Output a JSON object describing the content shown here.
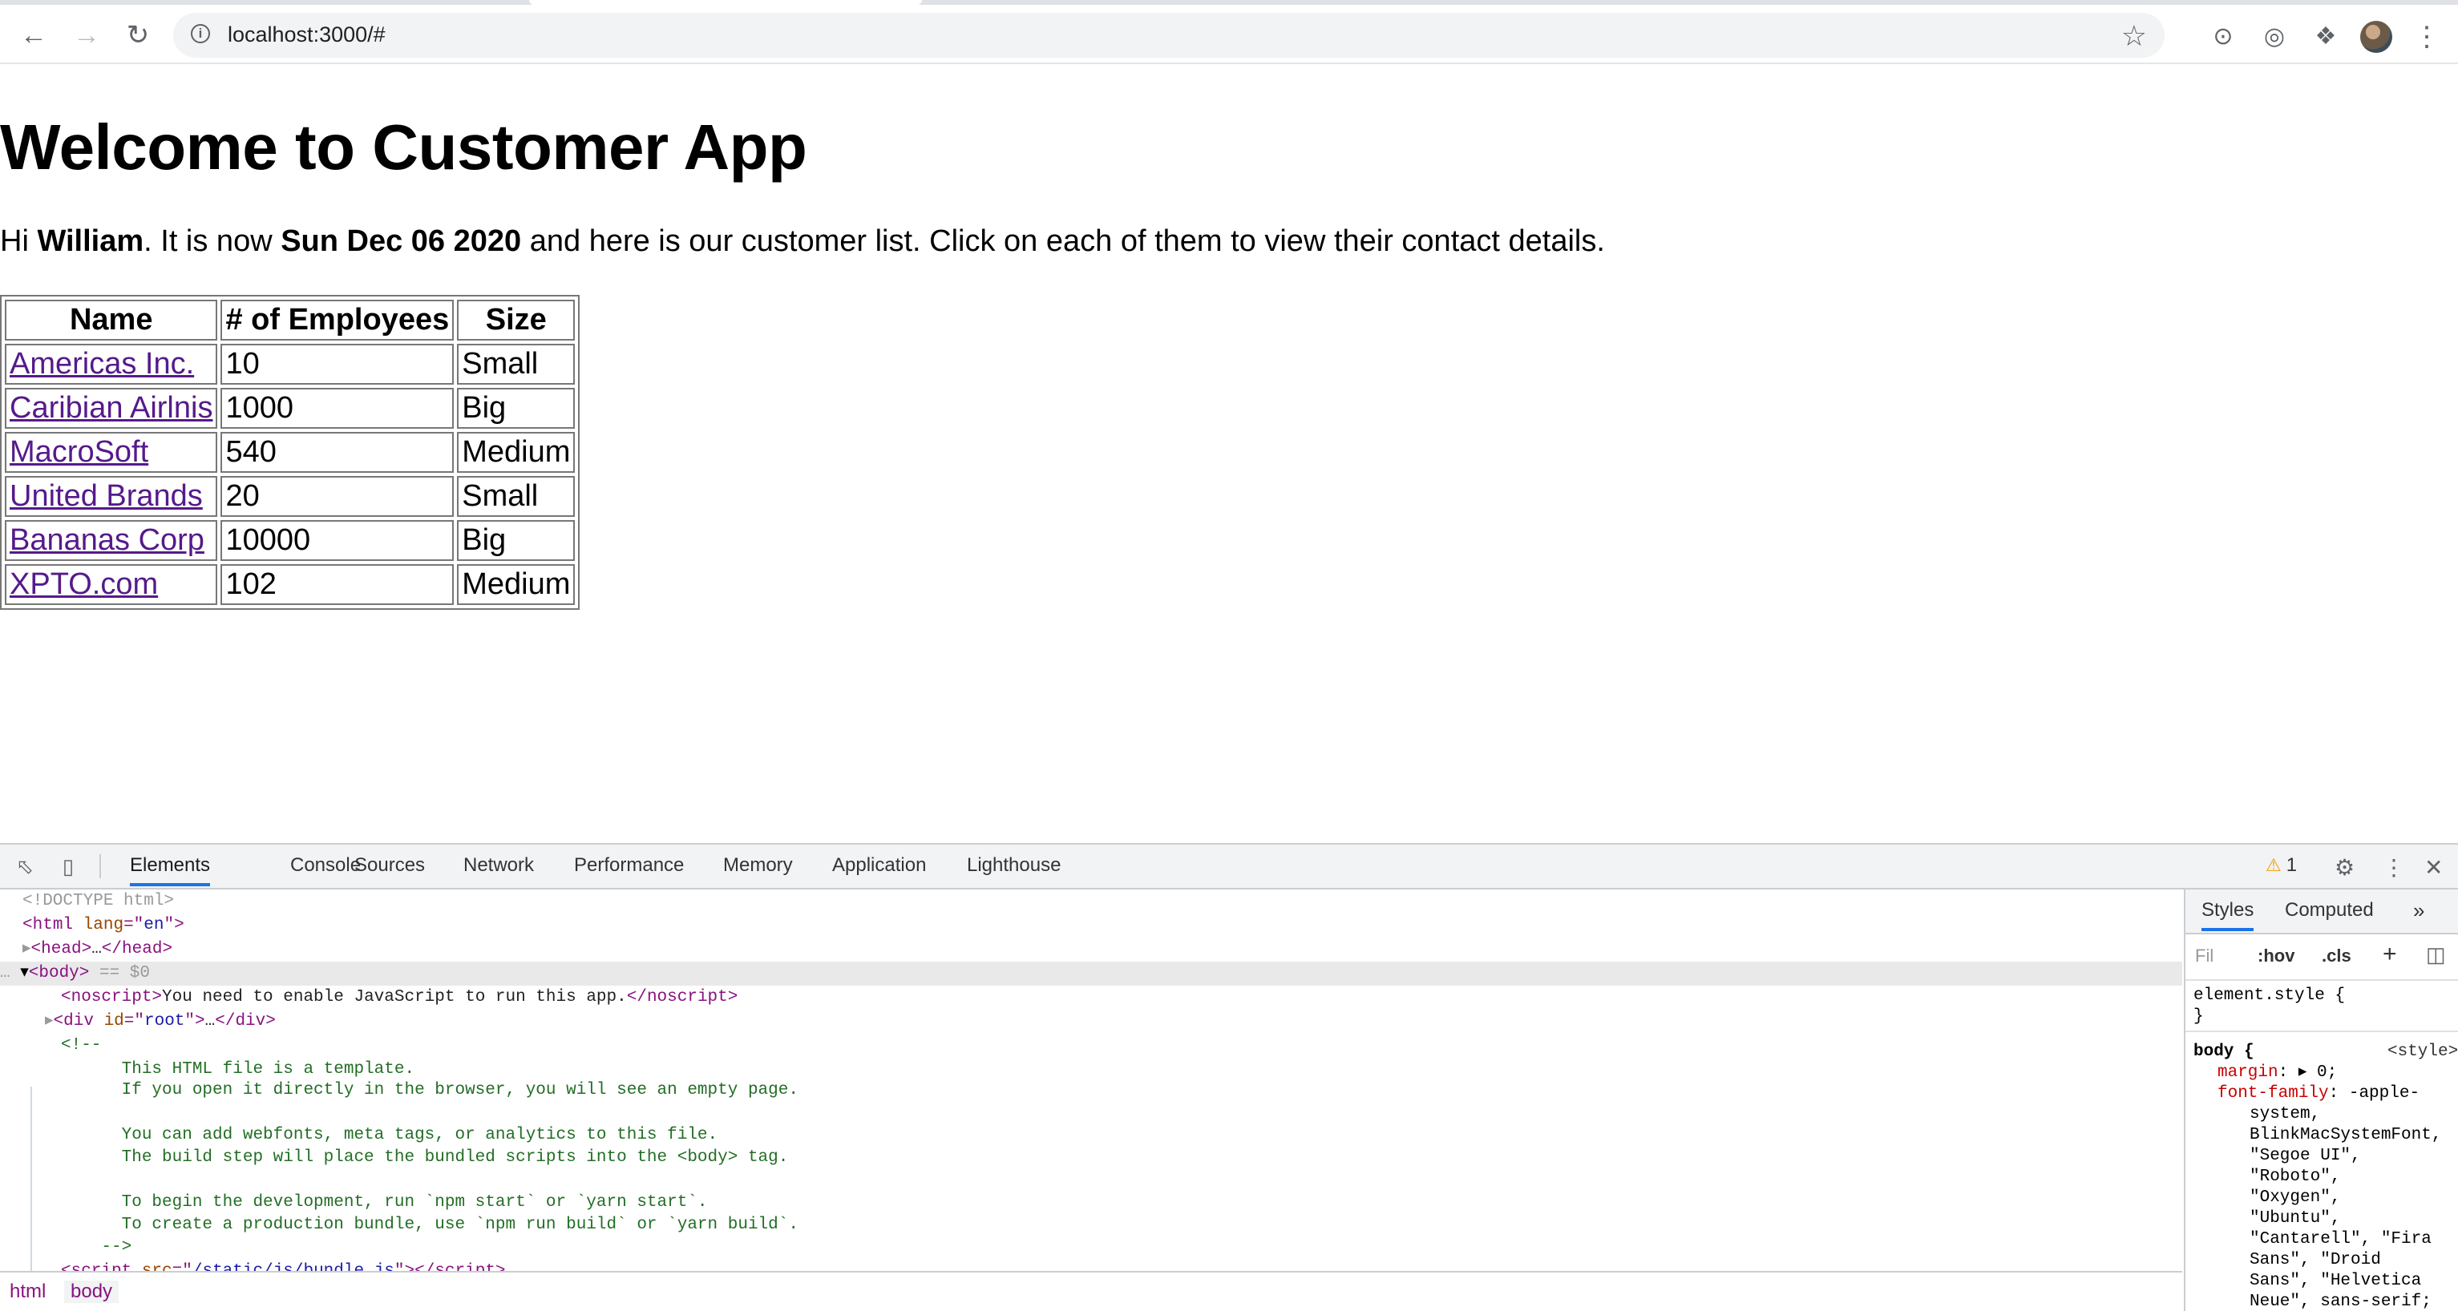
{
  "browser": {
    "url": "localhost:3000/#",
    "back_icon": "back-arrow-icon",
    "forward_icon": "forward-arrow-icon",
    "reload_icon": "reload-icon"
  },
  "page": {
    "heading": "Welcome to Customer App",
    "intro": {
      "hi": "Hi ",
      "name": "William",
      "mid": ". It is now ",
      "date": "Sun Dec 06 2020",
      "tail": " and here is our customer list. Click on each of them to view their contact details."
    },
    "table": {
      "headers": [
        "Name",
        "# of Employees",
        "Size"
      ],
      "rows": [
        {
          "name": "Americas Inc.",
          "employees": "10",
          "size": "Small"
        },
        {
          "name": "Caribian Airlnis",
          "employees": "1000",
          "size": "Big"
        },
        {
          "name": "MacroSoft",
          "employees": "540",
          "size": "Medium"
        },
        {
          "name": "United Brands",
          "employees": "20",
          "size": "Small"
        },
        {
          "name": "Bananas Corp",
          "employees": "10000",
          "size": "Big"
        },
        {
          "name": "XPTO.com",
          "employees": "102",
          "size": "Medium"
        }
      ]
    }
  },
  "devtools": {
    "tabs": [
      "Elements",
      "Console",
      "Sources",
      "Network",
      "Performance",
      "Memory",
      "Application",
      "Lighthouse"
    ],
    "active_tab": "Elements",
    "warning_count": "1",
    "elements": {
      "doctype": "<!DOCTYPE html>",
      "html_open": "html",
      "html_attr": "lang",
      "html_val": "en",
      "head": "head",
      "body_suffix": " == $0",
      "noscript_text": "You need to enable JavaScript to run this app.",
      "div_attr": "id",
      "div_val": "root",
      "comment_lines": [
        "<!--",
        "      This HTML file is a template.",
        "      If you open it directly in the browser, you will see an empty page.",
        "",
        "      You can add webfonts, meta tags, or analytics to this file.",
        "      The build step will place the bundled scripts into the <body> tag.",
        "",
        "      To begin the development, run `npm start` or `yarn start`.",
        "      To create a production bundle, use `npm run build` or `yarn build`.",
        "    -->"
      ],
      "script_src": "/static/js/bundle.js"
    },
    "breadcrumbs": [
      "html",
      "body"
    ],
    "styles": {
      "tabs": [
        "Styles",
        "Computed"
      ],
      "filter_placeholder": "Fil",
      "hov": ":hov",
      "cls": ".cls",
      "element_style": "element.style {",
      "close_brace": "}",
      "body_selector": "body {",
      "source": "<style>",
      "margin_prop": "margin",
      "margin_val": "0;",
      "font_prop": "font-family",
      "font_lines": [
        "-apple-",
        "system,",
        "BlinkMacSystemFont,",
        "\"Segoe UI\",",
        "\"Roboto\",",
        "\"Oxygen\",",
        "\"Ubuntu\",",
        "\"Cantarell\", \"Fira",
        "Sans\", \"Droid",
        "Sans\", \"Helvetica",
        "Neue\", sans-serif;"
      ]
    }
  }
}
